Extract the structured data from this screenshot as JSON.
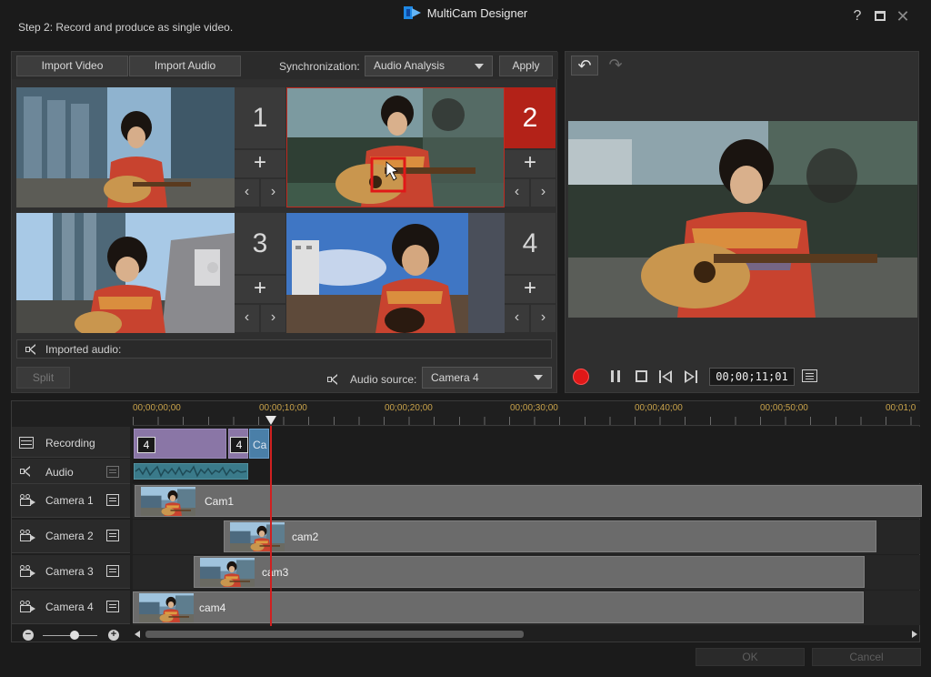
{
  "window": {
    "title": "MultiCam Designer",
    "step_label": "Step 2: Record and produce as single video.",
    "help": "?",
    "close": "✕"
  },
  "toolbar": {
    "import_video": "Import Video",
    "import_audio": "Import Audio",
    "sync_label": "Synchronization:",
    "sync_value": "Audio Analysis",
    "apply": "Apply"
  },
  "cameras": [
    {
      "number": "1",
      "active": false
    },
    {
      "number": "2",
      "active": true
    },
    {
      "number": "3",
      "active": false
    },
    {
      "number": "4",
      "active": false
    }
  ],
  "tile_controls": {
    "add": "+",
    "prev": "‹",
    "next": "›"
  },
  "imported_audio_label": "Imported audio:",
  "split_label": "Split",
  "audio_source": {
    "label": "Audio source:",
    "value": "Camera 4"
  },
  "preview": {
    "undo": "↶",
    "redo": "↷",
    "timecode": "00;00;11;01"
  },
  "ruler": {
    "ticks": [
      "00;00;00;00",
      "00;00;10;00",
      "00;00;20;00",
      "00;00;30;00",
      "00;00;40;00",
      "00;00;50;00",
      "00;01;0"
    ]
  },
  "tracks": [
    {
      "label": "Recording"
    },
    {
      "label": "Audio"
    },
    {
      "label": "Camera 1",
      "clip": "Cam1"
    },
    {
      "label": "Camera 2",
      "clip": "cam2"
    },
    {
      "label": "Camera 3",
      "clip": "cam3"
    },
    {
      "label": "Camera 4",
      "clip": "cam4"
    }
  ],
  "recording_clips": [
    {
      "badge": "4"
    },
    {
      "badge": "4"
    },
    {
      "badge": "Ca"
    }
  ],
  "zoom": {
    "minus": "−",
    "plus": "+",
    "level": 0.58
  },
  "footer": {
    "ok": "OK",
    "cancel": "Cancel"
  },
  "colors": {
    "accent_red": "#b32218",
    "timecode_gold": "#c8a24a",
    "recording_clip": "#8a76a6",
    "audio_wave": "#3a7a8a"
  }
}
